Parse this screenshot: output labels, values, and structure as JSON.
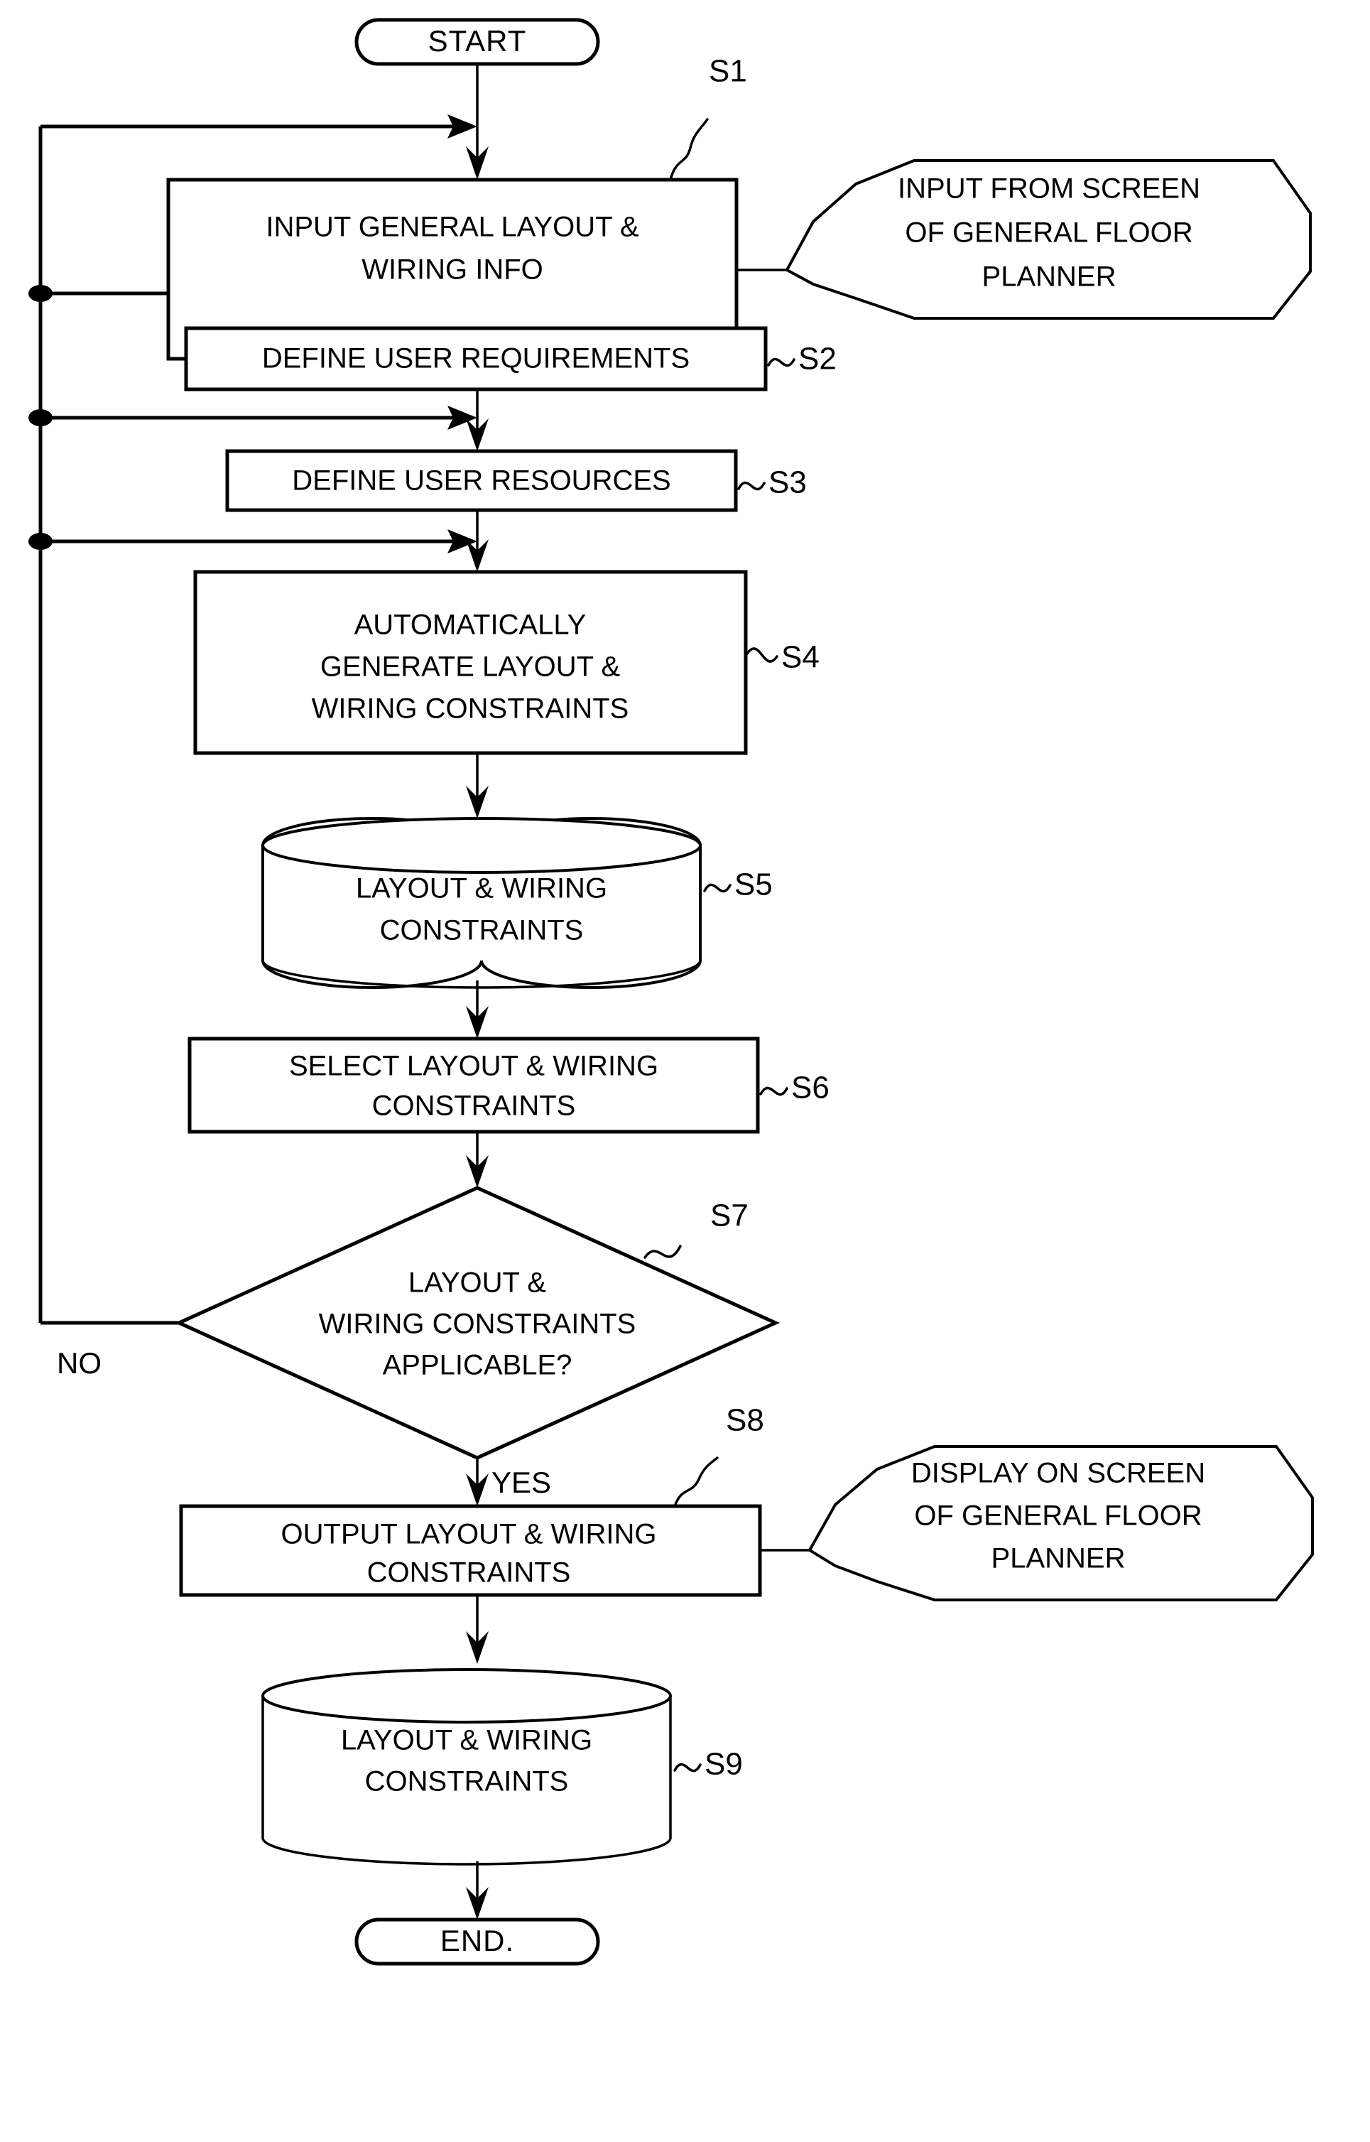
{
  "diagram": {
    "title": "Layout and wiring constraint generation flowchart",
    "background_color": "#ffffff",
    "line_color": "#000000"
  },
  "nodes": {
    "start": {
      "label": "START",
      "shape": "terminator"
    },
    "s1": {
      "step_id": "S1",
      "lines": [
        "INPUT GENERAL LAYOUT &",
        "WIRING INFO"
      ],
      "shape": "process"
    },
    "s2": {
      "step_id": "S2",
      "lines": [
        "DEFINE USER REQUIREMENTS"
      ],
      "shape": "process"
    },
    "s3": {
      "step_id": "S3",
      "lines": [
        "DEFINE USER RESOURCES"
      ],
      "shape": "process"
    },
    "s4": {
      "step_id": "S4",
      "lines": [
        "AUTOMATICALLY",
        "GENERATE LAYOUT &",
        "WIRING CONSTRAINTS"
      ],
      "shape": "process"
    },
    "s5": {
      "step_id": "S5",
      "lines": [
        "LAYOUT & WIRING",
        "CONSTRAINTS"
      ],
      "shape": "database"
    },
    "s6": {
      "step_id": "S6",
      "lines": [
        "SELECT LAYOUT & WIRING",
        "CONSTRAINTS"
      ],
      "shape": "process"
    },
    "s7": {
      "step_id": "S7",
      "lines": [
        "LAYOUT &",
        "WIRING CONSTRAINTS",
        "APPLICABLE?"
      ],
      "shape": "decision"
    },
    "s8": {
      "step_id": "S8",
      "lines": [
        "OUTPUT LAYOUT & WIRING",
        "CONSTRAINTS"
      ],
      "shape": "process"
    },
    "s9": {
      "step_id": "S9",
      "lines": [
        "LAYOUT & WIRING",
        "CONSTRAINTS"
      ],
      "shape": "database"
    },
    "end": {
      "label": "END.",
      "shape": "terminator"
    }
  },
  "annotations": {
    "input_note": {
      "lines": [
        "INPUT FROM SCREEN",
        "OF GENERAL FLOOR",
        "PLANNER"
      ],
      "shape": "hexagon-callout"
    },
    "display_note": {
      "lines": [
        "DISPLAY ON SCREEN",
        "OF GENERAL FLOOR",
        "PLANNER"
      ],
      "shape": "hexagon-callout"
    }
  },
  "branches": {
    "no_label": "NO",
    "yes_label": "YES"
  },
  "step_ids": {
    "s1": "S1",
    "s2": "S2",
    "s3": "S3",
    "s4": "S4",
    "s5": "S5",
    "s6": "S6",
    "s7": "S7",
    "s8": "S8",
    "s9": "S9"
  }
}
